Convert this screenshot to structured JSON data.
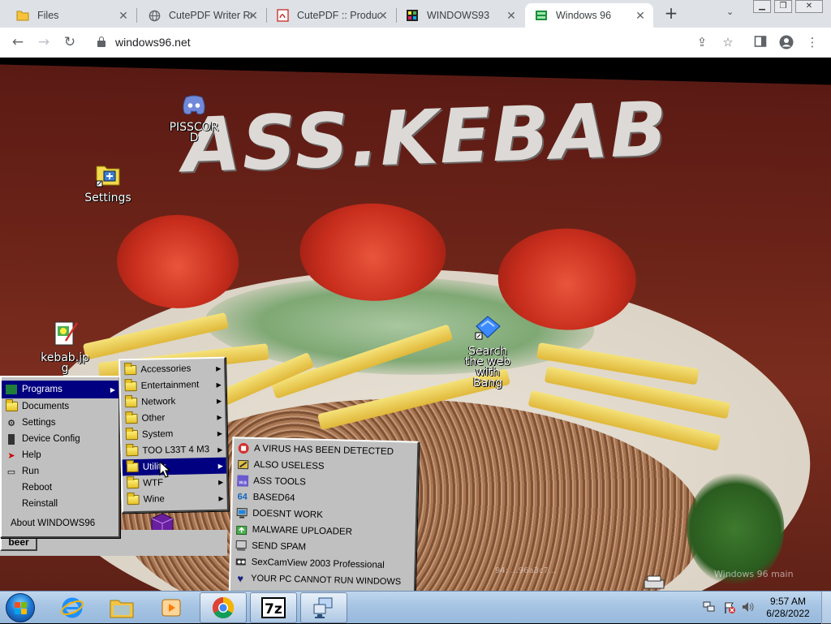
{
  "browser": {
    "tabs": [
      {
        "title": "Files",
        "icon": "folder-icon"
      },
      {
        "title": "CutePDF Writer Re",
        "icon": "globe-icon"
      },
      {
        "title": "CutePDF :: Produc",
        "icon": "pdf-icon"
      },
      {
        "title": "WINDOWS93",
        "icon": "windows93-icon"
      },
      {
        "title": "Windows 96",
        "icon": "windows96-icon",
        "active": true
      }
    ],
    "new_tab_label": "+",
    "url": "windows96.net"
  },
  "desktop": {
    "wallpaper_title": "ASS.KEBAB",
    "icons": [
      {
        "label": "PISSCORD",
        "icon": "discord-icon"
      },
      {
        "label": "Settings",
        "icon": "settings-icon"
      },
      {
        "label": "kebab.jpg",
        "icon": "image-file-icon"
      },
      {
        "label": "Search the web with Bang",
        "icon": "bang-search-icon"
      }
    ],
    "watermark": "Windows 96 main",
    "watermark2": "94: ...96a3c7..."
  },
  "start_menu": {
    "items": [
      {
        "label": "Programs",
        "selected": true,
        "submenu": true
      },
      {
        "label": "Documents"
      },
      {
        "label": "Settings"
      },
      {
        "label": "Device Config"
      },
      {
        "label": "Help"
      },
      {
        "label": "Run"
      },
      {
        "label": "Reboot"
      },
      {
        "label": "Reinstall"
      },
      {
        "label": "About WINDOWS96"
      }
    ],
    "start_button": "beer"
  },
  "programs_menu": {
    "items": [
      {
        "label": "Accessories"
      },
      {
        "label": "Entertainment"
      },
      {
        "label": "Network"
      },
      {
        "label": "Other"
      },
      {
        "label": "System"
      },
      {
        "label": "TOO L33T 4 M3"
      },
      {
        "label": "Utility",
        "selected": true
      },
      {
        "label": "WTF"
      },
      {
        "label": "Wine"
      }
    ]
  },
  "utility_menu": {
    "items": [
      {
        "label": "A VIRUS HAS BEEN DETECTED"
      },
      {
        "label": "ALSO USELESS"
      },
      {
        "label": "ASS TOOLS"
      },
      {
        "label": "BASED64"
      },
      {
        "label": "DOESNT WORK"
      },
      {
        "label": "MALWARE UPLOADER"
      },
      {
        "label": "SEND SPAM"
      },
      {
        "label": "SexCamView 2003 Professional"
      },
      {
        "label": "YOUR PC CANNOT RUN WINDOWS"
      }
    ]
  },
  "taskbar": {
    "clock_time": "9:57 AM",
    "clock_date": "6/28/2022"
  },
  "colors": {
    "menu_bg": "#c0c0c0",
    "menu_selected": "#000080",
    "chrome_tabstrip": "#dee1e6"
  }
}
